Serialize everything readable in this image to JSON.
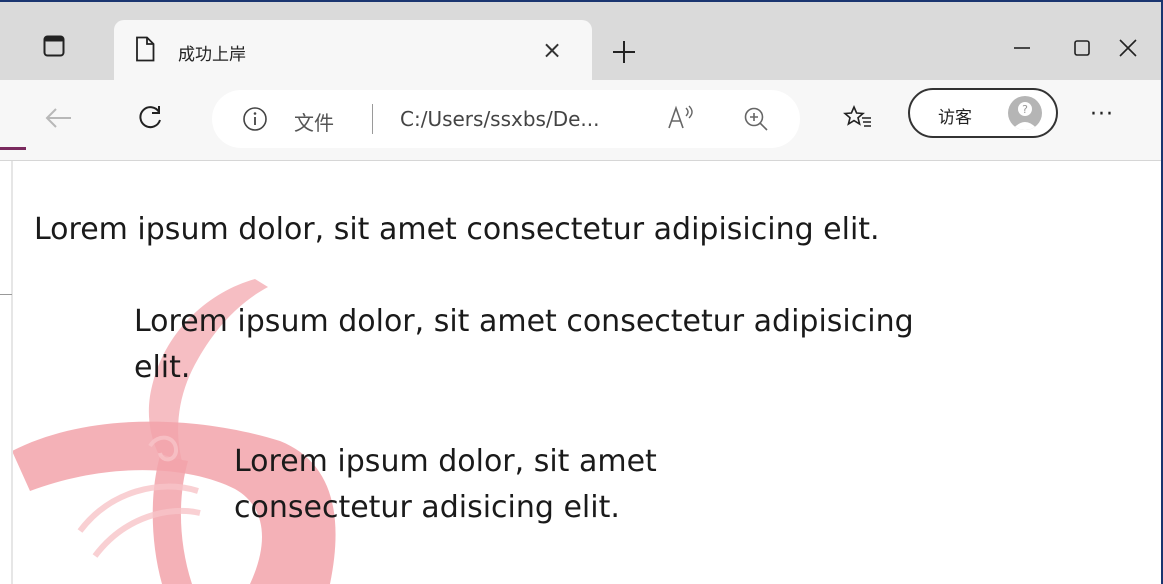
{
  "tab": {
    "title": "成功上岸",
    "close_glyph": "×",
    "new_tab_glyph": "+"
  },
  "toolbar": {
    "file_label": "文件",
    "url": "C:/Users/ssxbs/De...",
    "guest_label": "访客",
    "more_glyph": "···"
  },
  "icons": {
    "tab_actions": "tab-actions-icon",
    "page": "document-icon",
    "back": "back-arrow-icon",
    "refresh": "refresh-icon",
    "info": "info-icon",
    "read_aloud": "read-aloud-icon",
    "zoom": "zoom-in-icon",
    "favorites": "favorites-icon",
    "avatar": "guest-avatar-icon",
    "minimize": "minimize-icon",
    "maximize": "maximize-icon",
    "close": "close-icon"
  },
  "content": {
    "p1": "Lorem ipsum dolor, sit amet consectetur adipisicing elit.",
    "p2": "Lorem ipsum dolor, sit amet consectetur adipisicing elit.",
    "p3": "Lorem ipsum dolor, sit amet consectetur adisicing elit."
  },
  "colors": {
    "watermark": "#f4b3b8",
    "frame": "#1a3570",
    "accent": "#7a2a5e"
  }
}
